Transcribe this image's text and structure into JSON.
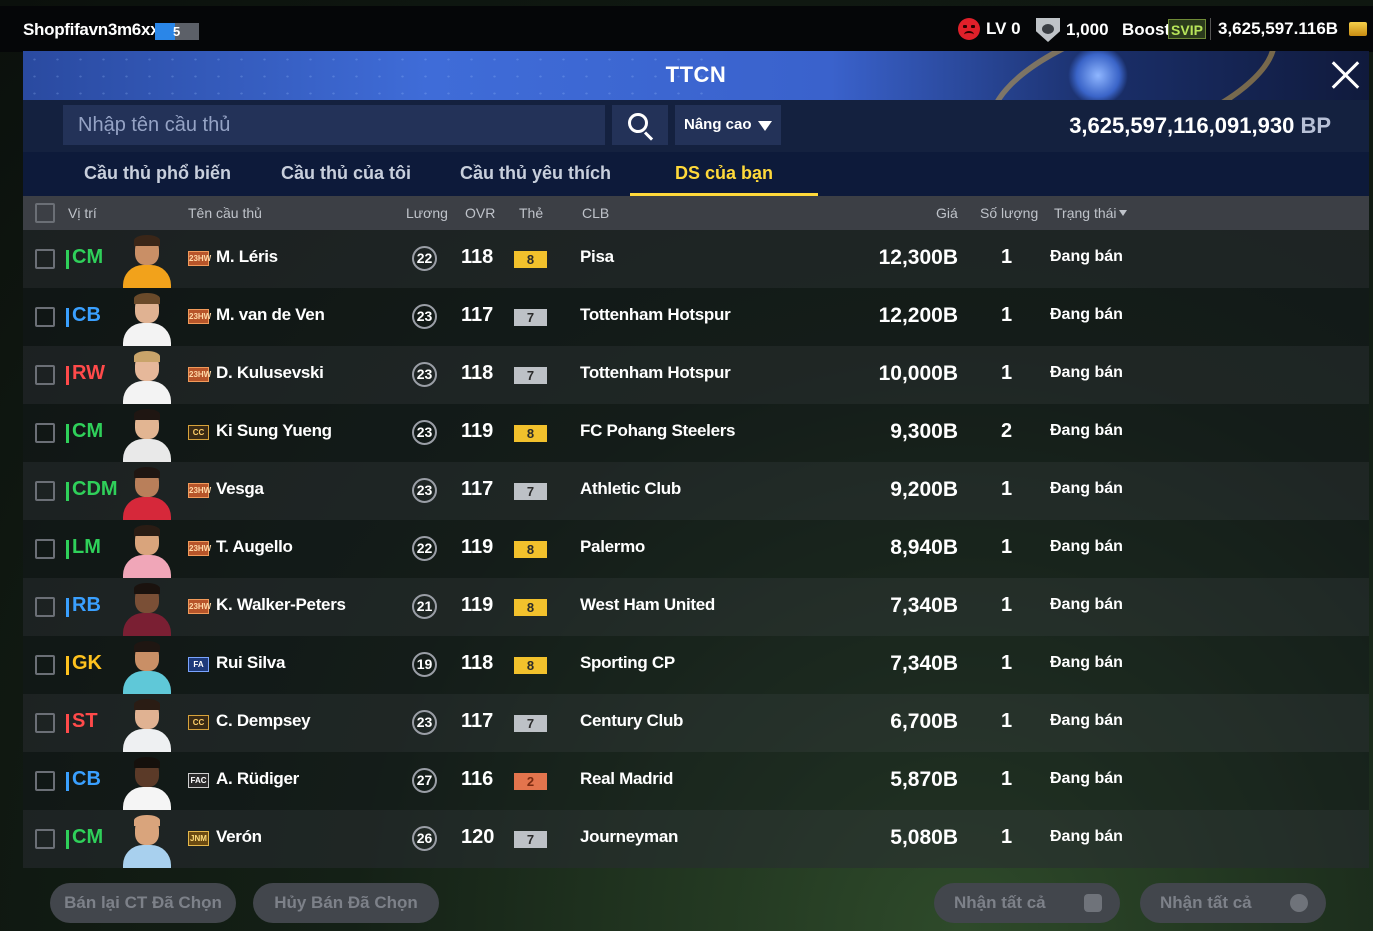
{
  "topbar": {
    "username": "Shopfifavn3m6xx",
    "user_level": "5",
    "user_level_fill": 0.45,
    "lv_label": "LV 0",
    "coins": "1,000",
    "boost_label": "Boost",
    "svip_label": "SVIP",
    "bp_short": "3,625,597.116B"
  },
  "header": {
    "title": "TTCN"
  },
  "search": {
    "placeholder": "Nhập tên cầu thủ",
    "advanced_label": "Nâng cao",
    "bp_amount": "3,625,597,116,091,930",
    "bp_unit": "BP"
  },
  "tabs": [
    {
      "label": "Cầu thủ phổ biến",
      "active": false
    },
    {
      "label": "Cầu thủ của tôi",
      "active": false
    },
    {
      "label": "Cầu thủ yêu thích",
      "active": false
    },
    {
      "label": "DS của bạn",
      "active": true
    }
  ],
  "columns": {
    "position": "Vị trí",
    "name": "Tên cầu thủ",
    "wage": "Lương",
    "ovr": "OVR",
    "grade": "Thẻ",
    "club": "CLB",
    "price": "Giá",
    "qty": "Số lượng",
    "status": "Trạng thái"
  },
  "colors": {
    "pos_mid": "#2fd05a",
    "pos_def": "#3aa0ff",
    "pos_att": "#ff4a4a",
    "pos_gk": "#ffc21e",
    "grade_gold": "#f2c12c",
    "grade_silver": "#bdc1c6",
    "grade_bronze": "#e3744d",
    "tab_active": "#ffd93a"
  },
  "players": [
    {
      "pos": "CM",
      "pos_group": "mid",
      "season": "23HW",
      "name": "M. Léris",
      "wage": "22",
      "ovr": "118",
      "grade": "8",
      "grade_tier": "gold",
      "club": "Pisa",
      "price": "12,300B",
      "qty": "1",
      "status": "Đang bán",
      "shirt_color": "#f2a21b",
      "hair_color": "#3a2618",
      "skin_color": "#c98f66"
    },
    {
      "pos": "CB",
      "pos_group": "def",
      "season": "23HW",
      "name": "M. van de Ven",
      "wage": "23",
      "ovr": "117",
      "grade": "7",
      "grade_tier": "silver",
      "club": "Tottenham Hotspur",
      "price": "12,200B",
      "qty": "1",
      "status": "Đang bán",
      "shirt_color": "#f3f3f3",
      "hair_color": "#6a4a2a",
      "skin_color": "#e0b292"
    },
    {
      "pos": "RW",
      "pos_group": "att",
      "season": "23HW",
      "name": "D. Kulusevski",
      "wage": "23",
      "ovr": "118",
      "grade": "7",
      "grade_tier": "silver",
      "club": "Tottenham Hotspur",
      "price": "10,000B",
      "qty": "1",
      "status": "Đang bán",
      "shirt_color": "#f3f3f3",
      "hair_color": "#c9a46a",
      "skin_color": "#e6b89a"
    },
    {
      "pos": "CM",
      "pos_group": "mid",
      "season": "CC",
      "name": "Ki Sung Yueng",
      "wage": "23",
      "ovr": "119",
      "grade": "8",
      "grade_tier": "gold",
      "club": "FC Pohang Steelers",
      "price": "9,300B",
      "qty": "2",
      "status": "Đang bán",
      "shirt_color": "#e9e9e9",
      "hair_color": "#1f1612",
      "skin_color": "#e2b592"
    },
    {
      "pos": "CDM",
      "pos_group": "mid",
      "season": "23HW",
      "name": "Vesga",
      "wage": "23",
      "ovr": "117",
      "grade": "7",
      "grade_tier": "silver",
      "club": "Athletic Club",
      "price": "9,200B",
      "qty": "1",
      "status": "Đang bán",
      "shirt_color": "#d6283a",
      "hair_color": "#1f1612",
      "skin_color": "#b97f5a"
    },
    {
      "pos": "LM",
      "pos_group": "mid",
      "season": "23HW",
      "name": "T. Augello",
      "wage": "22",
      "ovr": "119",
      "grade": "8",
      "grade_tier": "gold",
      "club": "Palermo",
      "price": "8,940B",
      "qty": "1",
      "status": "Đang bán",
      "shirt_color": "#f0a6b8",
      "hair_color": "#2a1c14",
      "skin_color": "#d9a47c"
    },
    {
      "pos": "RB",
      "pos_group": "def",
      "season": "23HW",
      "name": "K. Walker-Peters",
      "wage": "21",
      "ovr": "119",
      "grade": "8",
      "grade_tier": "gold",
      "club": "West Ham United",
      "price": "7,340B",
      "qty": "1",
      "status": "Đang bán",
      "shirt_color": "#7a1f33",
      "hair_color": "#1a120e",
      "skin_color": "#7a4f36"
    },
    {
      "pos": "GK",
      "pos_group": "gk",
      "season": "FA",
      "name": "Rui Silva",
      "wage": "19",
      "ovr": "118",
      "grade": "8",
      "grade_tier": "gold",
      "club": "Sporting CP",
      "price": "7,340B",
      "qty": "1",
      "status": "Đang bán",
      "shirt_color": "#5fc8d8",
      "hair_color": "#1f1612",
      "skin_color": "#c98f66"
    },
    {
      "pos": "ST",
      "pos_group": "att",
      "season": "CC",
      "name": "C. Dempsey",
      "wage": "23",
      "ovr": "117",
      "grade": "7",
      "grade_tier": "silver",
      "club": "Century Club",
      "price": "6,700B",
      "qty": "1",
      "status": "Đang bán",
      "shirt_color": "#eef0f2",
      "hair_color": "#2a1c14",
      "skin_color": "#e0b292"
    },
    {
      "pos": "CB",
      "pos_group": "def",
      "season": "FAC",
      "name": "A. Rüdiger",
      "wage": "27",
      "ovr": "116",
      "grade": "2",
      "grade_tier": "bronze",
      "club": "Real Madrid",
      "price": "5,870B",
      "qty": "1",
      "status": "Đang bán",
      "shirt_color": "#f5f5f5",
      "hair_color": "#15100c",
      "skin_color": "#5b3a28"
    },
    {
      "pos": "CM",
      "pos_group": "mid",
      "season": "JNM",
      "name": "Verón",
      "wage": "26",
      "ovr": "120",
      "grade": "7",
      "grade_tier": "silver",
      "club": "Journeyman",
      "price": "5,080B",
      "qty": "1",
      "status": "Đang bán",
      "shirt_color": "#a8d0ee",
      "hair_color": "#d9a47c",
      "skin_color": "#d9a47c"
    }
  ],
  "footer": {
    "resell_label": "Bán lại CT Đã Chọn",
    "cancel_label": "Hủy Bán Đã Chọn",
    "collect_label_1": "Nhận tất cả",
    "collect_label_2": "Nhận tất cả"
  }
}
